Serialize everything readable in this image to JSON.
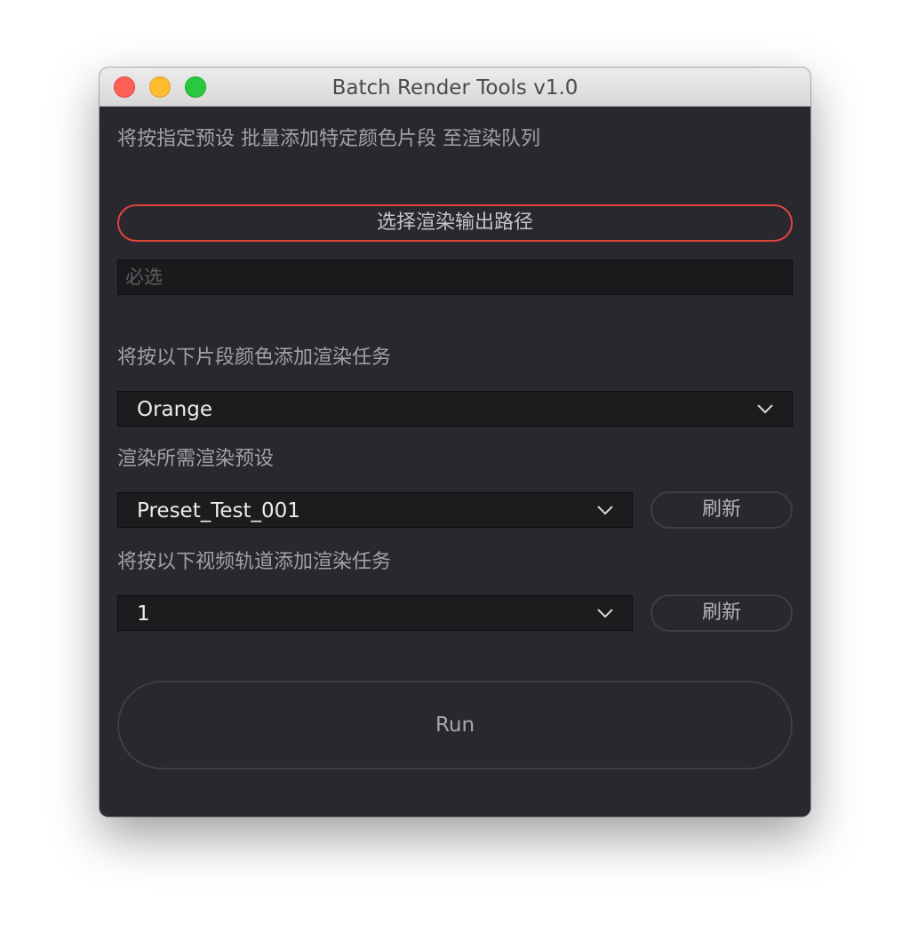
{
  "window": {
    "title": "Batch Render Tools v1.0"
  },
  "description": "将按指定预设 批量添加特定颜色片段 至渲染队列",
  "output_path": {
    "button_label": "选择渲染输出路径",
    "placeholder": "必选",
    "value": ""
  },
  "clip_color": {
    "label": "将按以下片段颜色添加渲染任务",
    "selected": "Orange"
  },
  "render_preset": {
    "label": "渲染所需渲染预设",
    "selected": "Preset_Test_001",
    "refresh_label": "刷新"
  },
  "video_track": {
    "label": "将按以下视频轨道添加渲染任务",
    "selected": "1",
    "refresh_label": "刷新"
  },
  "run_label": "Run",
  "colors": {
    "window_bg": "#28282e",
    "accent_border": "#e0443c",
    "close": "#fe5f57",
    "minimize": "#febc2e",
    "maximize": "#28c840"
  }
}
